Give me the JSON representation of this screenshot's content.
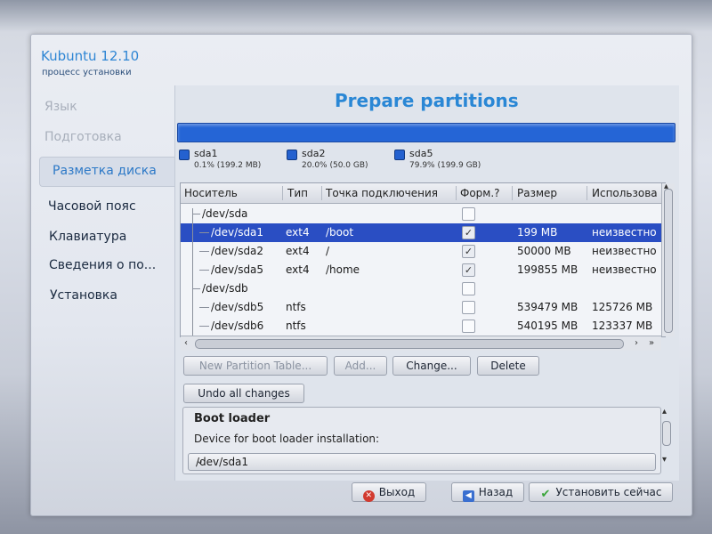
{
  "app": {
    "title": "Kubuntu 12.10",
    "subtitle": "процесс установки"
  },
  "sidebar": {
    "items": [
      {
        "label": "Язык",
        "state": "done"
      },
      {
        "label": "Подготовка",
        "state": "done"
      },
      {
        "label": "Разметка диска",
        "state": "active"
      },
      {
        "label": "Часовой пояс",
        "state": "todo"
      },
      {
        "label": "Клавиатура",
        "state": "todo"
      },
      {
        "label": "Сведения о по...",
        "state": "todo"
      },
      {
        "label": "Установка",
        "state": "todo"
      }
    ]
  },
  "page": {
    "title": "Prepare partitions"
  },
  "usage": {
    "color": "#2565d6",
    "legend": [
      {
        "name": "sda1",
        "detail": "0.1% (199.2 MB)"
      },
      {
        "name": "sda2",
        "detail": "20.0% (50.0 GB)"
      },
      {
        "name": "sda5",
        "detail": "79.9% (199.9 GB)"
      }
    ]
  },
  "table": {
    "headers": [
      "Носитель",
      "Тип",
      "Точка подключения",
      "Форм.?",
      "Размер",
      "Использова"
    ],
    "rows": [
      {
        "device": "/dev/sda",
        "type": "",
        "mount": "",
        "format": false,
        "size": "",
        "used": "",
        "level": 0,
        "selected": false
      },
      {
        "device": "/dev/sda1",
        "type": "ext4",
        "mount": "/boot",
        "format": true,
        "size": "199 MB",
        "used": "неизвестно",
        "level": 1,
        "selected": true
      },
      {
        "device": "/dev/sda2",
        "type": "ext4",
        "mount": "/",
        "format": true,
        "size": "50000 MB",
        "used": "неизвестно",
        "level": 1,
        "selected": false
      },
      {
        "device": "/dev/sda5",
        "type": "ext4",
        "mount": "/home",
        "format": true,
        "size": "199855 MB",
        "used": "неизвестно",
        "level": 1,
        "selected": false
      },
      {
        "device": "/dev/sdb",
        "type": "",
        "mount": "",
        "format": false,
        "size": "",
        "used": "",
        "level": 0,
        "selected": false
      },
      {
        "device": "/dev/sdb5",
        "type": "ntfs",
        "mount": "",
        "format": false,
        "size": "539479 MB",
        "used": "125726 MB",
        "level": 1,
        "selected": false
      },
      {
        "device": "/dev/sdb6",
        "type": "ntfs",
        "mount": "",
        "format": false,
        "size": "540195 MB",
        "used": "123337 MB",
        "level": 1,
        "selected": false
      }
    ]
  },
  "buttons": {
    "new_table": "New Partition Table...",
    "add": "Add...",
    "change": "Change...",
    "delete": "Delete",
    "undo": "Undo all changes"
  },
  "bootloader": {
    "title": "Boot loader",
    "label": "Device for boot loader installation:",
    "device": "/dev/sda1"
  },
  "footer": {
    "quit": "Выход",
    "back": "Назад",
    "install": "Установить сейчас"
  },
  "icons": {
    "quit": "close-icon",
    "back": "arrow-left-icon",
    "install": "checkmark-icon",
    "tick": "✓",
    "chevron": "⌄"
  }
}
